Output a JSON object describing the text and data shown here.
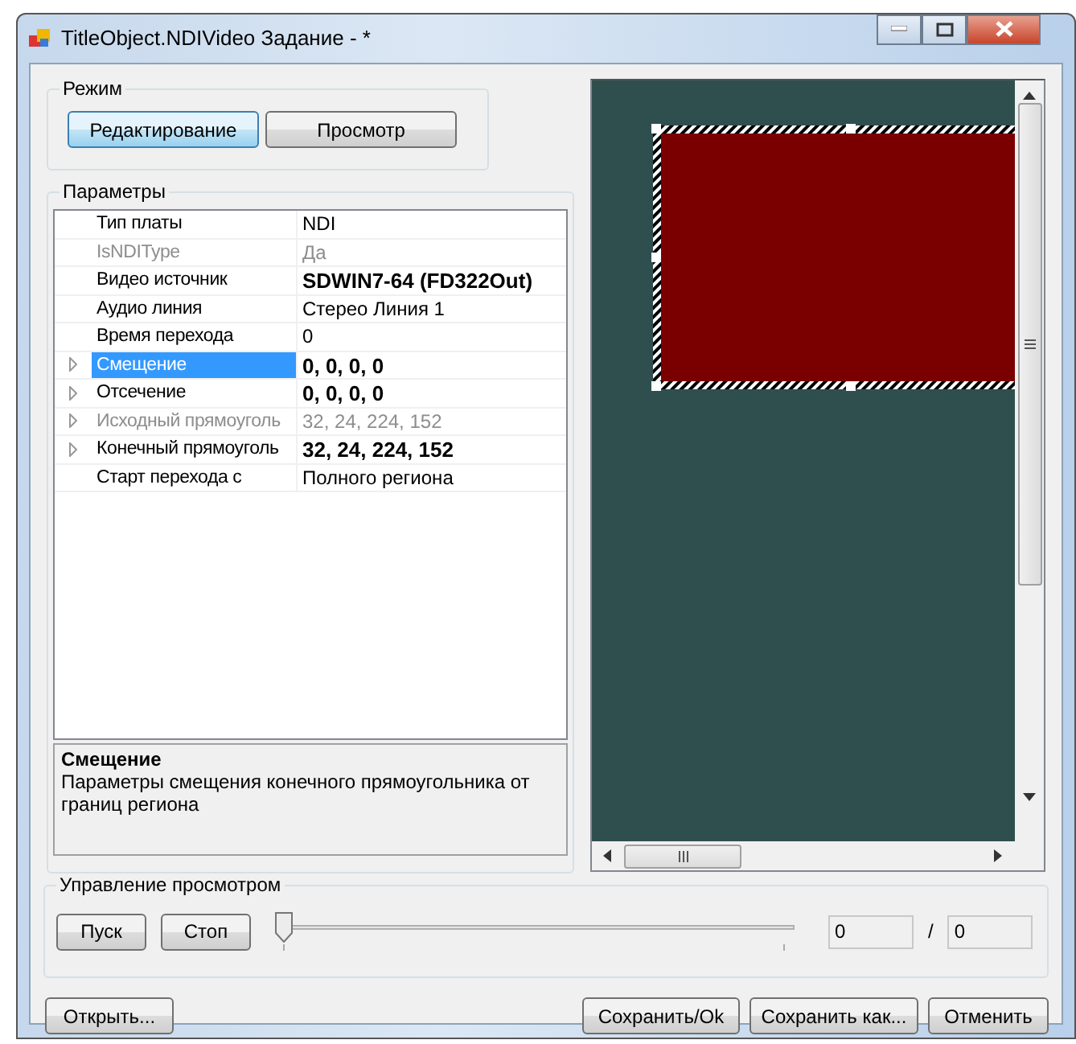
{
  "window": {
    "title": "TitleObject.NDIVideo Задание -  *"
  },
  "mode": {
    "label": "Режим",
    "buttons": [
      {
        "label": "Редактирование",
        "selected": true
      },
      {
        "label": "Просмотр",
        "selected": false
      }
    ]
  },
  "parameters": {
    "label": "Параметры",
    "rows": [
      {
        "name": "Тип платы",
        "value": "NDI",
        "bold": false,
        "disabled": false,
        "expandable": false,
        "selected": false
      },
      {
        "name": "IsNDIType",
        "value": "Да",
        "bold": false,
        "disabled": true,
        "expandable": false,
        "selected": false
      },
      {
        "name": "Видео источник",
        "value": "SDWIN7-64 (FD322Out)",
        "bold": true,
        "disabled": false,
        "expandable": false,
        "selected": false
      },
      {
        "name": "Аудио линия",
        "value": "Стерео Линия 1",
        "bold": false,
        "disabled": false,
        "expandable": false,
        "selected": false
      },
      {
        "name": "Время перехода",
        "value": "0",
        "bold": false,
        "disabled": false,
        "expandable": false,
        "selected": false
      },
      {
        "name": "Смещение",
        "value": "0, 0, 0, 0",
        "bold": true,
        "disabled": false,
        "expandable": true,
        "selected": true
      },
      {
        "name": "Отсечение",
        "value": "0, 0, 0, 0",
        "bold": true,
        "disabled": false,
        "expandable": true,
        "selected": false
      },
      {
        "name": "Исходный прямоуголь",
        "value": "32, 24, 224, 152",
        "bold": false,
        "disabled": true,
        "expandable": true,
        "selected": false
      },
      {
        "name": "Конечный прямоуголь",
        "value": "32, 24, 224, 152",
        "bold": true,
        "disabled": false,
        "expandable": true,
        "selected": false
      },
      {
        "name": "Старт перехода с",
        "value": "Полного региона",
        "bold": false,
        "disabled": false,
        "expandable": false,
        "selected": false
      }
    ],
    "description": {
      "title": "Смещение",
      "text": "Параметры смещения конечного прямоугольника от границ региона"
    }
  },
  "playback": {
    "label": "Управление просмотром",
    "buttons": [
      "Пуск",
      "Стоп"
    ],
    "slider": {
      "level": 0
    },
    "current": "0",
    "separator": "/",
    "total": "0"
  },
  "footer": {
    "left_buttons": [
      "Открыть..."
    ],
    "right_buttons": [
      "Сохранить/Ok",
      "Сохранить как...",
      "Отменить"
    ]
  }
}
